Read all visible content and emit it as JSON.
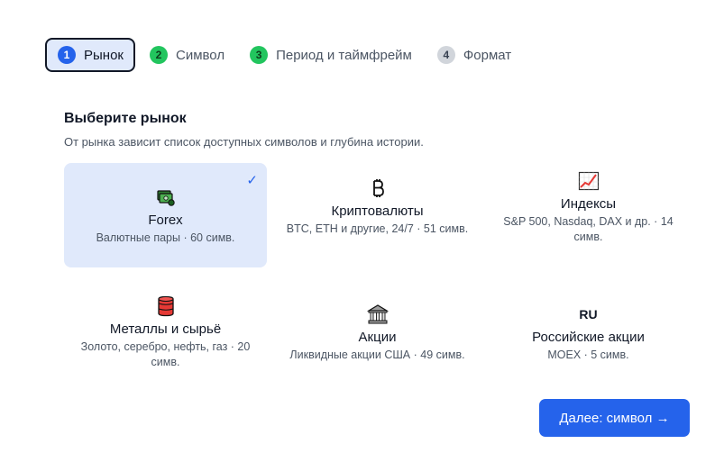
{
  "stepper": {
    "steps": [
      {
        "num": "1",
        "label": "Рынок",
        "state": "active"
      },
      {
        "num": "2",
        "label": "Символ",
        "state": "done"
      },
      {
        "num": "3",
        "label": "Период и таймфрейм",
        "state": "done"
      },
      {
        "num": "4",
        "label": "Формат",
        "state": "pending"
      }
    ]
  },
  "header": {
    "title": "Выберите рынок",
    "subtitle": "От рынка зависит список доступных символов и глубина истории."
  },
  "markets": [
    {
      "name": "Forex",
      "desc": "Валютные пары · 60 симв.",
      "icon": "money-icon",
      "selected": true,
      "check": "✓"
    },
    {
      "name": "Криптовалюты",
      "desc": "BTC, ETH и другие, 24/7 · 51 симв.",
      "icon": "bitcoin-icon",
      "selected": false
    },
    {
      "name": "Индексы",
      "desc": "S&P 500, Nasdaq, DAX и др. · 14 симв.",
      "icon": "chart-up-icon",
      "selected": false
    },
    {
      "name": "Металлы и сырьё",
      "desc": "Золото, серебро, нефть, газ · 20 симв.",
      "icon": "barrel-icon",
      "selected": false
    },
    {
      "name": "Акции",
      "desc": "Ликвидные акции США · 49 симв.",
      "icon": "bank-icon",
      "selected": false
    },
    {
      "name": "Российские акции",
      "desc": "MOEX · 5 симв.",
      "icon": "ru-text-icon",
      "icon_text": "RU",
      "selected": false
    }
  ],
  "footer": {
    "next_label": "Далее: символ →"
  },
  "colors": {
    "accent": "#2563eb",
    "selected_bg": "#e0e9fb",
    "done": "#22c55e",
    "pending": "#d1d5db"
  }
}
